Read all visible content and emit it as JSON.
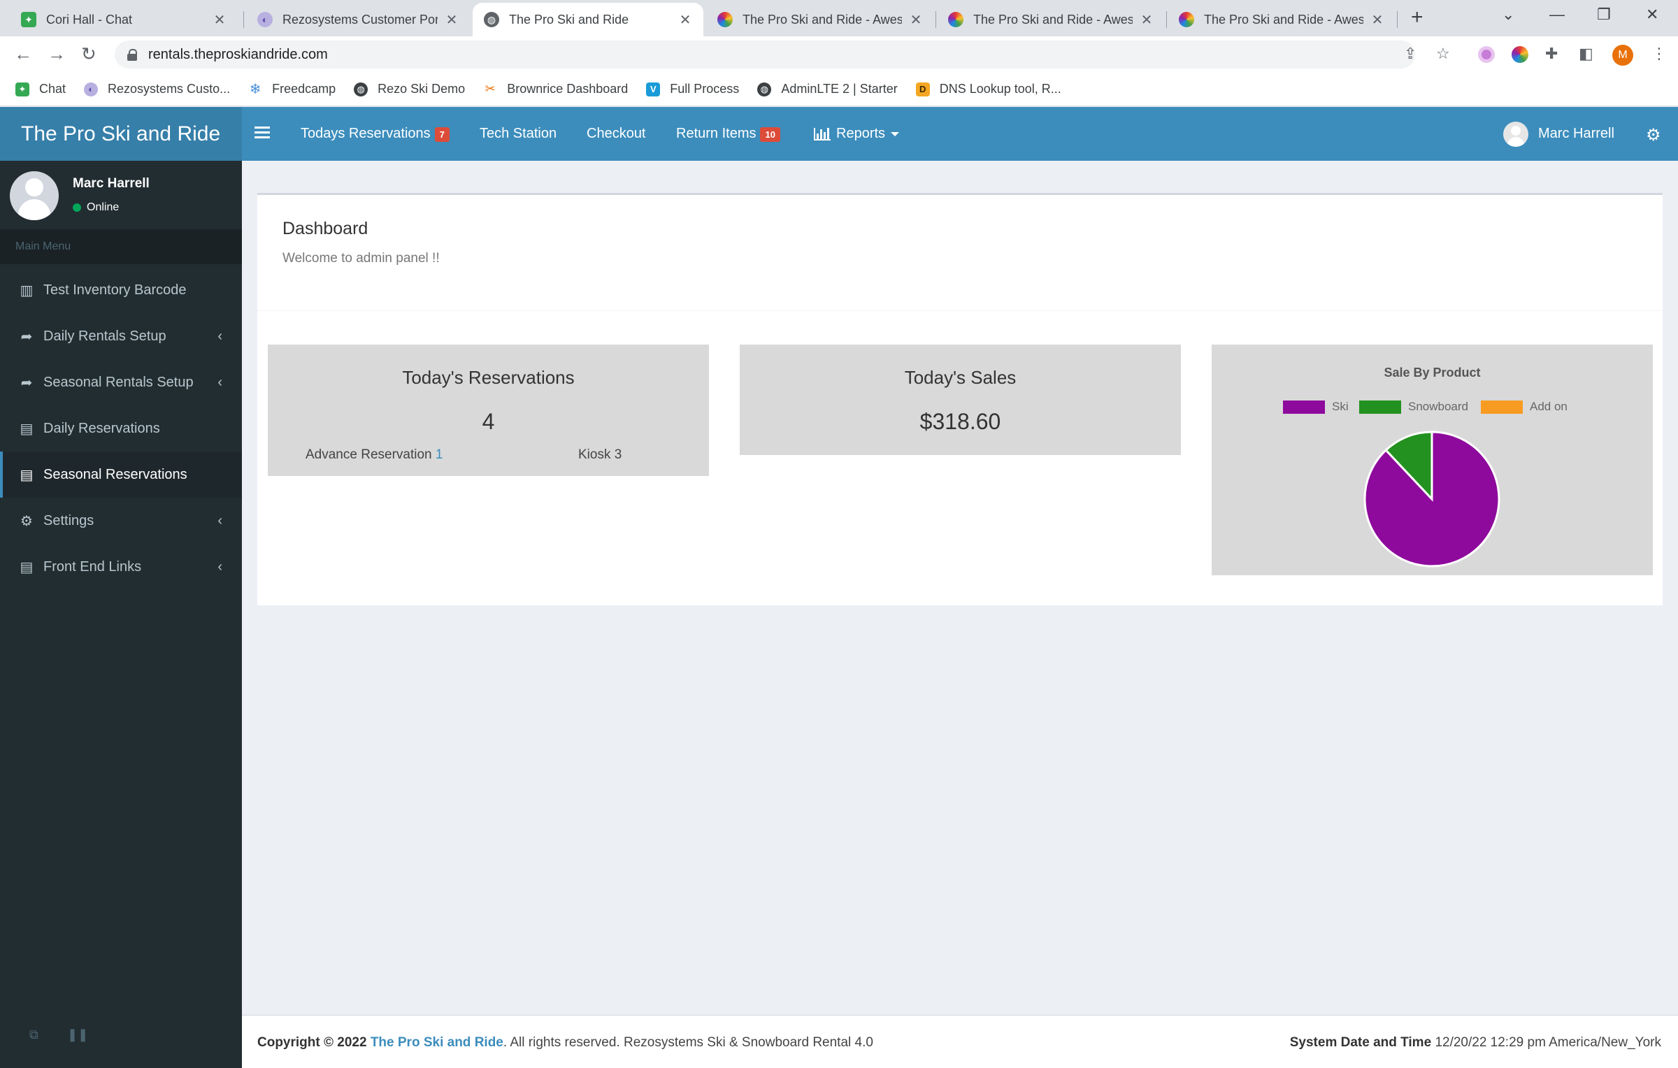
{
  "browser": {
    "tabs": [
      {
        "title": "Cori Hall - Chat",
        "icon": "chat-icon",
        "color": "#34a853"
      },
      {
        "title": "Rezosystems Customer Portal",
        "icon": "portal-icon",
        "color": "#8a7cc9"
      },
      {
        "title": "The Pro Ski and Ride",
        "icon": "globe-icon",
        "color": "#5f6368"
      },
      {
        "title": "The Pro Ski and Ride - Aweso",
        "icon": "colorwheel-icon",
        "color": "#c2185b"
      },
      {
        "title": "The Pro Ski and Ride - Aweso",
        "icon": "colorwheel-icon",
        "color": "#c2185b"
      },
      {
        "title": "The Pro Ski and Ride - Aweso",
        "icon": "colorwheel-icon",
        "color": "#c2185b"
      }
    ],
    "url": "rentals.theproskiandride.com",
    "profile_initial": "M",
    "bookmarks": [
      {
        "label": "Chat",
        "color": "#34a853"
      },
      {
        "label": "Rezosystems Custo...",
        "color": "#8a7cc9"
      },
      {
        "label": "Freedcamp",
        "color": "#4a90d9"
      },
      {
        "label": "Rezo Ski Demo",
        "color": "#3c4043"
      },
      {
        "label": "Brownrice Dashboard",
        "color": "#e8710a"
      },
      {
        "label": "Full Process",
        "color": "#1a9bd7"
      },
      {
        "label": "AdminLTE 2 | Starter",
        "color": "#3c4043"
      },
      {
        "label": "DNS Lookup tool, R...",
        "color": "#f5a623"
      }
    ]
  },
  "app": {
    "brand": "The Pro Ski and Ride",
    "nav": {
      "todays_reservations": "Todays Reservations",
      "todays_reservations_badge": "7",
      "tech_station": "Tech Station",
      "checkout": "Checkout",
      "return_items": "Return Items",
      "return_items_badge": "10",
      "reports": "Reports"
    },
    "user_name": "Marc Harrell"
  },
  "sidebar": {
    "user_name": "Marc Harrell",
    "status": "Online",
    "menu_header": "Main Menu",
    "items": [
      {
        "label": "Test Inventory Barcode",
        "icon": "barcode-icon"
      },
      {
        "label": "Daily Rentals Setup",
        "icon": "share-icon"
      },
      {
        "label": "Seasonal Rentals Setup",
        "icon": "share-icon"
      },
      {
        "label": "Daily Reservations",
        "icon": "book-icon"
      },
      {
        "label": "Seasonal Reservations",
        "icon": "book-icon"
      },
      {
        "label": "Settings",
        "icon": "gears-icon"
      },
      {
        "label": "Front End Links",
        "icon": "book-icon"
      }
    ]
  },
  "dashboard": {
    "title": "Dashboard",
    "subtitle": "Welcome to admin panel !!",
    "reservations": {
      "title": "Today's Reservations",
      "value": "4",
      "advance_label": "Advance Reservation",
      "advance_value": "1",
      "kiosk_label": "Kiosk",
      "kiosk_value": "3"
    },
    "sales": {
      "title": "Today's Sales",
      "value": "$318.60"
    }
  },
  "chart_data": {
    "type": "pie",
    "title": "Sale By Product",
    "categories": [
      "Ski",
      "Snowboard",
      "Add on"
    ],
    "values": [
      88,
      12,
      0
    ],
    "colors": [
      "#8e0a9c",
      "#23911f",
      "#f79b22"
    ],
    "legend": "top"
  },
  "footer": {
    "copyright_prefix": "Copyright © 2022",
    "brand_link": "The Pro Ski and Ride",
    "rights": ". All rights reserved. Rezosystems Ski & Snowboard Rental 4.0",
    "system_label": "System Date and Time",
    "system_value": "12/20/22 12:29 pm America/New_York"
  }
}
